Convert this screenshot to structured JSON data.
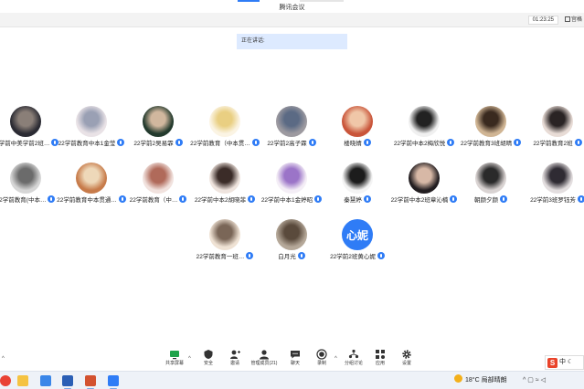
{
  "window": {
    "title": "腾讯会议"
  },
  "top": {
    "timer": "01:23:25",
    "view_label": "宫格"
  },
  "speaking": {
    "label": "正在讲话:"
  },
  "colors": {
    "accent": "#2f7cf6",
    "speaking_bg": "#ddeaff",
    "ime_red": "#e9432a"
  },
  "participants": [
    {
      "name": "22学前中美学前2班…",
      "avatar_bg": "#2b2b33",
      "avatar_fg": "#8a7f78"
    },
    {
      "name": "22学前教育中本1金莹",
      "avatar_bg": "#e9e2e6",
      "avatar_fg": "#9aa0b4"
    },
    {
      "name": "22学前2吴易霏",
      "avatar_bg": "#233a2d",
      "avatar_fg": "#d1b79e"
    },
    {
      "name": "22学前教育（中本贯…",
      "avatar_bg": "#fbf4e4",
      "avatar_fg": "#e9cf82"
    },
    {
      "name": "22学前2高子霖",
      "avatar_bg": "#9d9aa0",
      "avatar_fg": "#5b6a84"
    },
    {
      "name": "楼晓婧",
      "avatar_bg": "#c9553a",
      "avatar_fg": "#f0c7a8"
    },
    {
      "name": "22学前中本2梅欣悦",
      "avatar_bg": "#f0f0f0",
      "avatar_fg": "#222222"
    },
    {
      "name": "22学前教育3班胡晴",
      "avatar_bg": "#d0b594",
      "avatar_fg": "#3a2a1f"
    },
    {
      "name": "22学前教育2班",
      "avatar_bg": "#e8dcd6",
      "avatar_fg": "#2a2424"
    },
    {
      "name": "22学前教育(中本…",
      "avatar_bg": "#d6d6d6",
      "avatar_fg": "#6b6b6b"
    },
    {
      "name": "22学前教育中本贯通…",
      "avatar_bg": "#c77b4a",
      "avatar_fg": "#eed8b9"
    },
    {
      "name": "22学前教育（中…",
      "avatar_bg": "#f1e2de",
      "avatar_fg": "#b06a5a"
    },
    {
      "name": "22学前中本2胡晓菲",
      "avatar_bg": "#efe4de",
      "avatar_fg": "#3b2c28"
    },
    {
      "name": "22学前中本1金婷昭",
      "avatar_bg": "#f4eef6",
      "avatar_fg": "#9b74c8"
    },
    {
      "name": "秦慧婷",
      "avatar_bg": "#f4f4f4",
      "avatar_fg": "#1c1c1c"
    },
    {
      "name": "22学前中本2班章沁楠",
      "avatar_bg": "#221d20",
      "avatar_fg": "#d7b8a6"
    },
    {
      "name": "朝颜夕颜",
      "avatar_bg": "#d9d3d2",
      "avatar_fg": "#2a2a2a"
    },
    {
      "name": "22学前3班罗钰芳",
      "avatar_bg": "#e3dedf",
      "avatar_fg": "#2f2b33"
    },
    {
      "name": "22学前教育一班…",
      "avatar_bg": "#efe2d4",
      "avatar_fg": "#7a6657"
    },
    {
      "name": "白月光",
      "avatar_bg": "#b5a899",
      "avatar_fg": "#5a4a3c"
    },
    {
      "name": "22学前2班黄心妮",
      "avatar_text": "心妮",
      "avatar_bg": "#2f7cf6"
    }
  ],
  "toolbar": {
    "items": [
      {
        "id": "share",
        "label": "共享屏幕",
        "icon": "share-screen-icon"
      },
      {
        "id": "security",
        "label": "安全",
        "icon": "shield-icon"
      },
      {
        "id": "invite",
        "label": "邀请",
        "icon": "invite-icon"
      },
      {
        "id": "members",
        "label": "管理成员(21)",
        "icon": "members-icon"
      },
      {
        "id": "chat",
        "label": "聊天",
        "icon": "chat-icon"
      },
      {
        "id": "record",
        "label": "录制",
        "icon": "record-icon"
      },
      {
        "id": "breakout",
        "label": "分组讨论",
        "icon": "breakout-icon"
      },
      {
        "id": "apps",
        "label": "应用",
        "icon": "apps-icon"
      },
      {
        "id": "settings",
        "label": "设置",
        "icon": "gear-icon"
      }
    ]
  },
  "ime": {
    "mode": "中"
  },
  "taskbar": {
    "weather_temp": "18°C",
    "weather_desc": "局部晴朗",
    "tray_caret": "^",
    "apps": [
      {
        "name": "chrome-icon",
        "color": "#e94235"
      },
      {
        "name": "file-explorer-icon",
        "color": "#f5c342"
      },
      {
        "name": "browser-icon",
        "color": "#3a86e8"
      },
      {
        "name": "word-icon",
        "color": "#2b5fb5"
      },
      {
        "name": "powerpoint-icon",
        "color": "#d35230"
      },
      {
        "name": "meeting-app-icon",
        "color": "#2f7cf6"
      }
    ]
  }
}
